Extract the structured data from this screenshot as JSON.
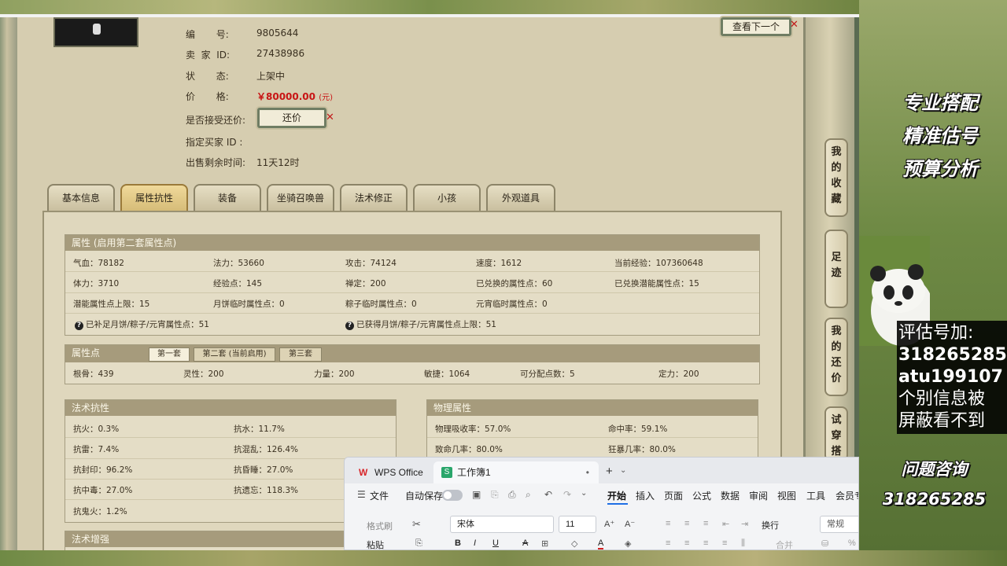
{
  "listing": {
    "rows": [
      {
        "key": "编       号:",
        "value": "9805644"
      },
      {
        "key": "卖  家  ID:",
        "value": "27438986"
      },
      {
        "key": "状       态:",
        "value": "上架中"
      },
      {
        "key": "价       格:",
        "value": "￥80000.00",
        "unit": "(元)"
      },
      {
        "key": "是否接受还价:",
        "value": ""
      },
      {
        "key": "指定买家 ID :",
        "value": ""
      },
      {
        "key": "出售剩余时间:",
        "value": "11天12时"
      }
    ],
    "counter_offer_btn": "还价",
    "next_btn": "查看下一个"
  },
  "tabs": [
    "基本信息",
    "属性抗性",
    "装备",
    "坐骑召唤兽",
    "法术修正",
    "小孩",
    "外观道具"
  ],
  "active_tab": 1,
  "attr": {
    "title": "属性 (启用第二套属性点)",
    "rows": [
      [
        "气血：78182",
        "法力：53660",
        "攻击：74124",
        "速度：1612",
        "当前经验：107360648"
      ],
      [
        "体力：3710",
        "经验点：145",
        "禅定：200",
        "已兑换的属性点：60",
        "已兑换潜能属性点：15"
      ],
      [
        "潜能属性点上限：15",
        "月饼临时属性点：0",
        "粽子临时属性点：0",
        "元宵临时属性点：0",
        ""
      ]
    ],
    "note1": "已补足月饼/粽子/元宵属性点：51",
    "note2": "已获得月饼/粽子/元宵属性点上限：51"
  },
  "points": {
    "title": "属性点",
    "subtabs": [
      "第一套",
      "第二套 (当前启用)",
      "第三套"
    ],
    "values": [
      "根骨：439",
      "灵性：200",
      "力量：200",
      "敏捷：1064",
      "可分配点数：5",
      "定力：200"
    ]
  },
  "resist": {
    "title": "法术抗性",
    "rows": [
      [
        "抗火：0.3%",
        "抗水：11.7%"
      ],
      [
        "抗雷：7.4%",
        "抗混乱：126.4%"
      ],
      [
        "抗封印：96.2%",
        "抗昏睡：27.0%"
      ],
      [
        "抗中毒：27.0%",
        "抗遗忘：118.3%"
      ],
      [
        "抗鬼火：1.2%",
        ""
      ]
    ]
  },
  "physical": {
    "title": "物理属性",
    "rows": [
      [
        "物理吸收率：57.0%",
        "命中率：59.1%"
      ],
      [
        "致命几率：80.0%",
        "狂暴几率：80.0%"
      ]
    ]
  },
  "spell_boost": {
    "title": "法术增强"
  },
  "side_tabs": [
    "我的收藏",
    "足迹",
    "我的还价",
    "试穿搭"
  ],
  "promo": {
    "lines": [
      "专业搭配",
      "精准估号",
      "预算分析"
    ],
    "box": [
      "评估号加:",
      "318265285",
      "atu199107",
      "个别信息被",
      "屏蔽看不到"
    ],
    "consult": [
      "问题咨询",
      "318265285"
    ]
  },
  "wps": {
    "tab_home": "WPS Office",
    "tab_doc": "工作簿1",
    "file": "文件",
    "autosave": "自动保存",
    "menus": [
      "开始",
      "插入",
      "页面",
      "公式",
      "数据",
      "审阅",
      "视图",
      "工具",
      "会员专"
    ],
    "format_painter": "格式刷",
    "paste": "粘贴",
    "font": "宋体",
    "size": "11",
    "wrap": "换行",
    "normal": "常规",
    "merge": "合并",
    "accent": "#1f6fe5"
  }
}
